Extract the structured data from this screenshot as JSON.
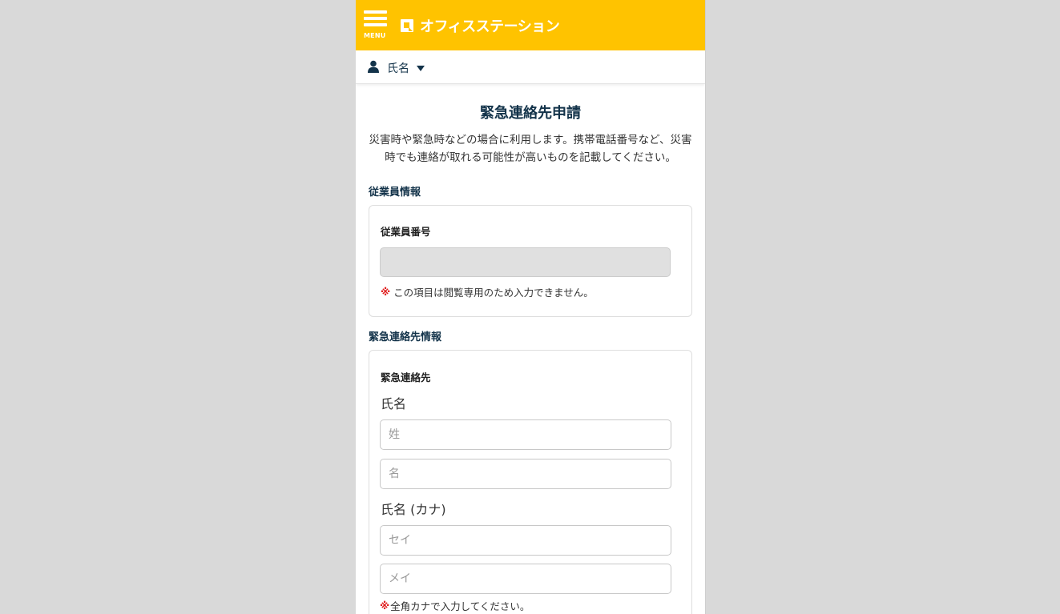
{
  "colors": {
    "header_bg": "#ffc300",
    "navy": "#13334a",
    "required_mark": "#e02020",
    "background": "#d9d9d9"
  },
  "header": {
    "menu_label": "MENU",
    "menu_icon": "hamburger-icon",
    "logo_icon": "office-station-logo-icon",
    "logo_text": "オフィスステーション"
  },
  "userbar": {
    "user_icon": "user-icon",
    "user_name": "氏名",
    "dropdown_icon": "caret-down-icon"
  },
  "main": {
    "title": "緊急連絡先申請",
    "description": "災害時や緊急時などの場合に利用します。携帯電話番号など、災害時でも連絡が取れる可能性が高いものを記載してください。"
  },
  "employee_section": {
    "title": "従業員情報",
    "employee_number_label": "従業員番号",
    "employee_number_value": "",
    "note_mark": "※",
    "note_text": "この項目は閲覧専用のため入力できません。"
  },
  "emergency_section": {
    "title": "緊急連絡先情報",
    "contact_label": "緊急連絡先",
    "name_label": "氏名",
    "last_name_placeholder": "姓",
    "first_name_placeholder": "名",
    "kana_label": "氏名 (カナ)",
    "last_name_kana_placeholder": "セイ",
    "first_name_kana_placeholder": "メイ",
    "kana_note_mark": "※",
    "kana_note_text": "全角カナで入力してください。"
  }
}
